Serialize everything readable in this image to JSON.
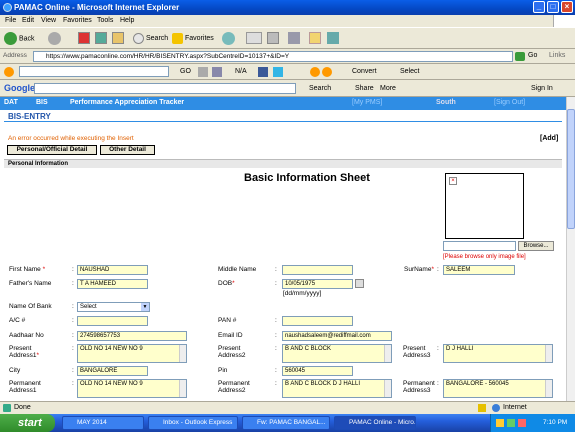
{
  "window": {
    "title": "PAMAC Online - Microsoft Internet Explorer"
  },
  "menu": [
    "File",
    "Edit",
    "View",
    "Favorites",
    "Tools",
    "Help"
  ],
  "toolbar": {
    "back": "Back",
    "search": "Search",
    "favorites": "Favorites"
  },
  "address": {
    "label": "Address",
    "url": "https://www.pamaconline.com/HR/HR/BISENTRY.aspx?SubCentreID=10137+&ID=Y",
    "go": "Go",
    "links": "Links"
  },
  "toolbar2": {
    "go": "GO",
    "na": "N/A",
    "convert": "Convert",
    "select": "Select"
  },
  "google": {
    "logo": "Google",
    "search": "Search",
    "share": "Share",
    "more": "More",
    "signin": "Sign In"
  },
  "app": {
    "nav": [
      "DAT",
      "BIS",
      "Performance Appreciation Tracker"
    ],
    "my_pms": "[My PMS]",
    "region": "South",
    "sign_out": "[Sign Out]",
    "section_title": "BIS-ENTRY",
    "error": "An error occurred while executing the Insert",
    "add": "[Add]",
    "tabs": [
      "Personal/Official Detail",
      "Other Detail"
    ],
    "personal_header": "Personal Information",
    "sheet_title": "Basic Information Sheet",
    "browse": "Browse...",
    "image_hint": "[Please browse only image  file]"
  },
  "form": {
    "first_name": {
      "label": "First Name",
      "value": "NAUSHAD"
    },
    "middle_name": {
      "label": "Middle Name",
      "value": ""
    },
    "surname": {
      "label": "SurName",
      "value": "SALEEM"
    },
    "fathers_name": {
      "label": "Father's Name",
      "value": "T A HAMEED"
    },
    "dob": {
      "label": "DOB",
      "value": "10/05/1975",
      "hint": "[dd/mm/yyyy]"
    },
    "bank": {
      "label": "Name Of Bank",
      "value": "Select"
    },
    "ac": {
      "label": "A/C #",
      "value": ""
    },
    "pan": {
      "label": "PAN #",
      "value": ""
    },
    "aadhar": {
      "label": "Aadhaar No",
      "value": "274598657753"
    },
    "email": {
      "label": "Email ID",
      "value": "naushadsaleem@rediffmail.com"
    },
    "present1": {
      "label1": "Present",
      "label2": "Address1",
      "value": "OLD NO 14 NEW NO 9"
    },
    "present2": {
      "label1": "Present",
      "label2": "Address2",
      "value": "B AND C BLOCK"
    },
    "present3": {
      "label1": "Present",
      "label2": "Address3",
      "value": "D J HALLI"
    },
    "city": {
      "label": "City",
      "value": "BANGALORE"
    },
    "pin": {
      "label": "Pin",
      "value": "560045"
    },
    "perm1": {
      "label1": "Permanent",
      "label2": "Address1",
      "value": "OLD NO 14 NEW NO 9"
    },
    "perm2": {
      "label1": "Permanent",
      "label2": "Address2",
      "value": "B AND C BLOCK D J HALLI"
    },
    "perm3": {
      "label1": "Permanent",
      "label2": "Address3",
      "value": "BANGALORE - 560045"
    }
  },
  "status": {
    "text": "Done",
    "zone": "Internet"
  },
  "taskbar": {
    "start": "start",
    "items": [
      "MAY 2014",
      "Inbox - Outlook Express",
      "Fw: PAMAC BANGAL...",
      "PAMAC Online - Micro..."
    ],
    "clock": "7:10 PM"
  }
}
